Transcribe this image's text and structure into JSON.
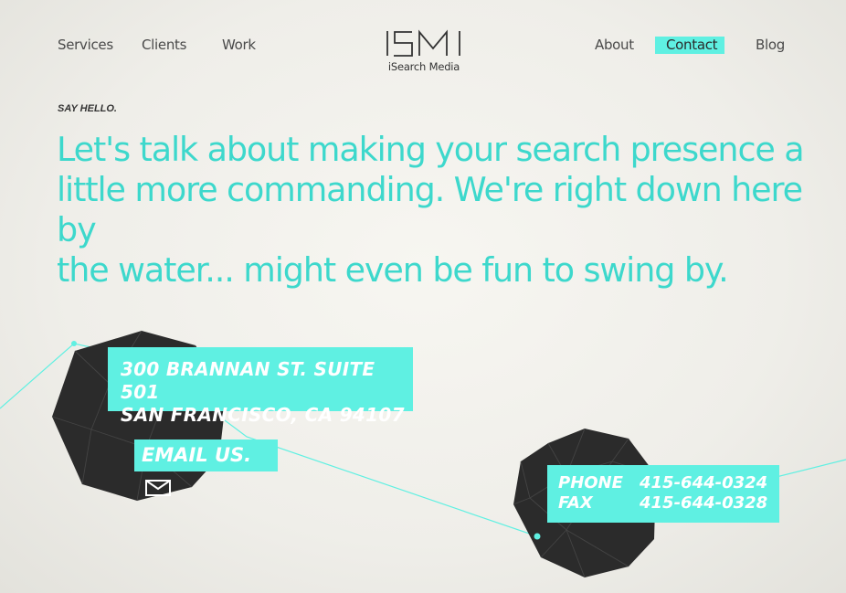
{
  "nav": {
    "services": "Services",
    "clients": "Clients",
    "work": "Work",
    "about": "About",
    "contact": "Contact",
    "blog": "Blog",
    "active": "Contact"
  },
  "logo": {
    "mark": "ISM",
    "name": "iSearch Media"
  },
  "intro": {
    "eyebrow": "SAY HELLO.",
    "headline_line1": "Let's talk about making your search presence a",
    "headline_line2": "little more commanding.  We're right down here by",
    "headline_line3": "the water... might even be fun to swing by."
  },
  "address": {
    "line1": "300 BRANNAN ST. SUITE 501",
    "line2": "SAN FRANCISCO, CA 94107"
  },
  "email": {
    "label": "EMAIL US.",
    "icon": "envelope-icon"
  },
  "contact": {
    "phone_label": "PHONE",
    "phone": "415-644-0324",
    "fax_label": "FAX",
    "fax": "415-644-0328"
  },
  "colors": {
    "accent": "#5ff0e2",
    "headline": "#3dd8cc",
    "text": "#4a4a4a",
    "sphere": "#2a2a2a"
  }
}
